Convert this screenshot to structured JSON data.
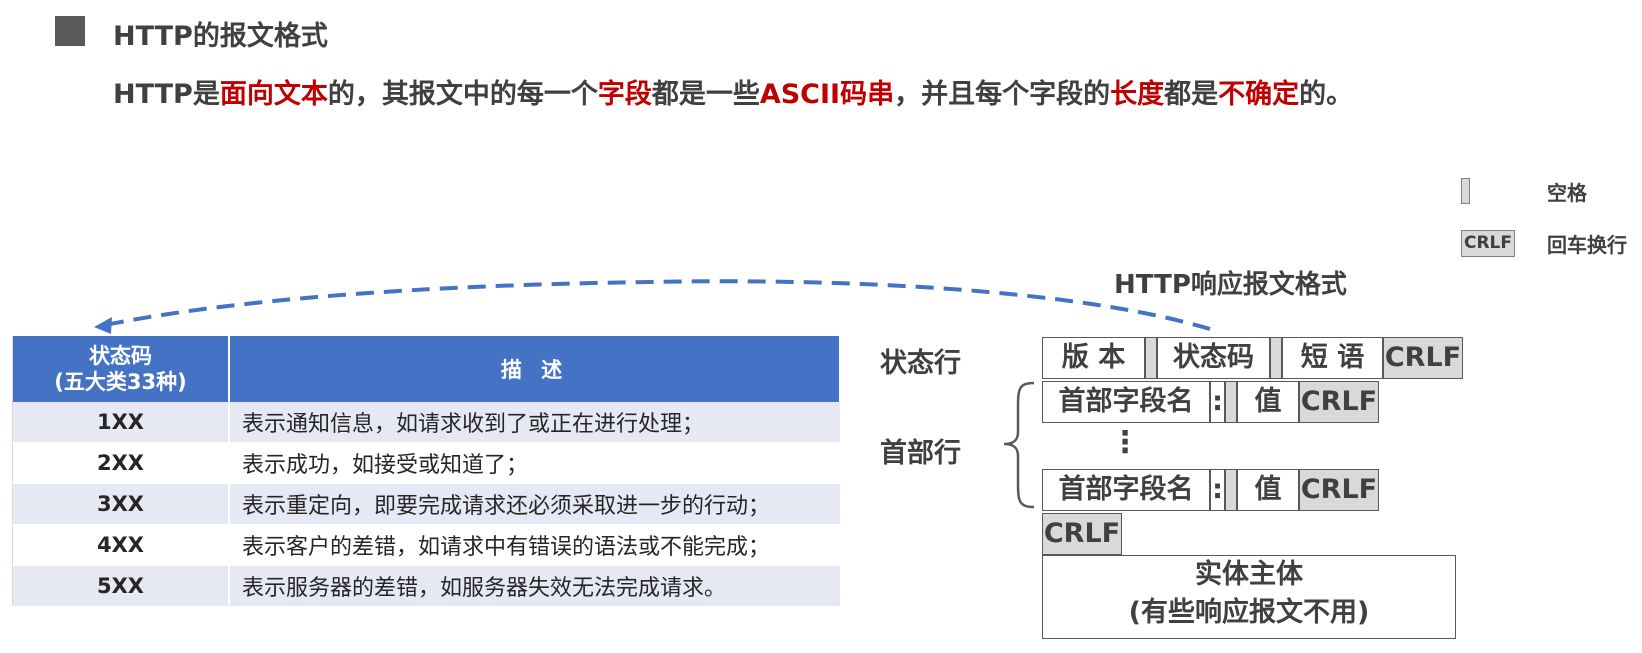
{
  "header": {
    "title": "HTTP的报文格式",
    "subtitle_parts": [
      {
        "text": "HTTP是",
        "hl": false
      },
      {
        "text": "面向文本",
        "hl": true
      },
      {
        "text": "的，其报文中的每一个",
        "hl": false
      },
      {
        "text": "字段",
        "hl": true
      },
      {
        "text": "都是一些",
        "hl": false
      },
      {
        "text": "ASCII码串",
        "hl": true
      },
      {
        "text": "，并且每个字段的",
        "hl": false
      },
      {
        "text": "长度",
        "hl": true
      },
      {
        "text": "都是",
        "hl": false
      },
      {
        "text": "不确定",
        "hl": true
      },
      {
        "text": "的。",
        "hl": false
      }
    ]
  },
  "legend": {
    "space_label": "空格",
    "crlf_box": "CRLF",
    "crlf_label": "回车换行"
  },
  "diagram": {
    "title": "HTTP响应报文格式",
    "status_line_label": "状态行",
    "header_line_label": "首部行",
    "version": "版 本",
    "status_code": "状态码",
    "phrase": "短 语",
    "crlf": "CRLF",
    "field_name": "首部字段名",
    "colon": ":",
    "value": "值",
    "ellipsis": "⋮",
    "entity_line1": "实体主体",
    "entity_line2": "(有些响应报文不用)"
  },
  "table": {
    "header_code_line1": "状态码",
    "header_code_line2": "(五大类33种)",
    "header_desc": "描 述",
    "rows": [
      {
        "code": "1XX",
        "desc": "表示通知信息，如请求收到了或正在进行处理；"
      },
      {
        "code": "2XX",
        "desc": "表示成功，如接受或知道了；"
      },
      {
        "code": "3XX",
        "desc": "表示重定向，即要完成请求还必须采取进一步的行动；"
      },
      {
        "code": "4XX",
        "desc": "表示客户的差错，如请求中有错误的语法或不能完成；"
      },
      {
        "code": "5XX",
        "desc": "表示服务器的差错，如服务器失效无法完成请求。"
      }
    ]
  },
  "colors": {
    "highlight": "#c00000",
    "table_header": "#4472c4",
    "arrow": "#4472c4",
    "field_gray": "#d9d9d9"
  }
}
